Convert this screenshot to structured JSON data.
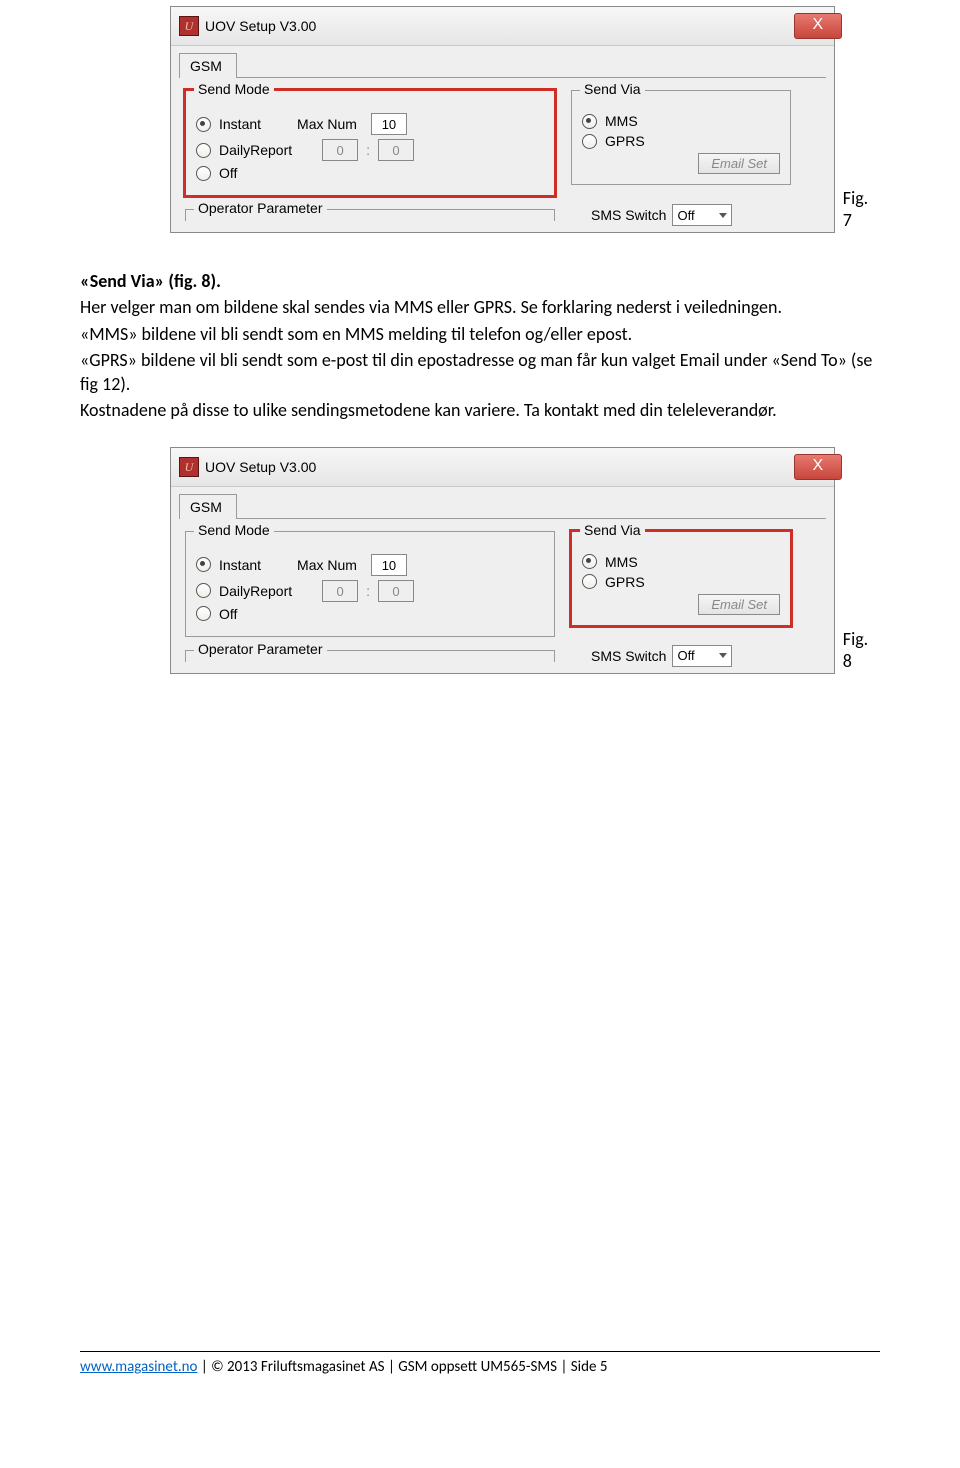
{
  "figures": {
    "fig7_caption": "Fig. 7",
    "fig8_caption": "Fig. 8"
  },
  "dialog": {
    "title": "UOV Setup V3.00",
    "icon_letter": "U",
    "close_symbol": "X",
    "tab_label": "GSM",
    "send_mode": {
      "group_title": "Send Mode",
      "instant_label": "Instant",
      "dailyreport_label": "DailyReport",
      "off_label": "Off",
      "maxnum_label": "Max Num",
      "maxnum_value": "10",
      "daily_h": "0",
      "daily_m": "0"
    },
    "send_via": {
      "group_title": "Send Via",
      "mms_label": "MMS",
      "gprs_label": "GPRS",
      "emailset_btn": "Email Set"
    },
    "operator_label": "Operator Parameter",
    "sms_switch_label": "SMS Switch",
    "sms_switch_value": "Off"
  },
  "text": {
    "heading": "«Send Via» (fig. 8).",
    "p1": "Her velger man om bildene skal sendes via MMS eller GPRS. Se forklaring nederst i veiledningen.",
    "p2": "«MMS» bildene vil bli sendt som en MMS melding til telefon og/eller epost.",
    "p3": "«GPRS» bildene vil bli sendt som e-post til din epostadresse og man får kun valget Email under «Send To» (se fig 12).",
    "p4": "Kostnadene på disse to ulike sendingsmetodene kan variere. Ta kontakt med din teleleverandør."
  },
  "footer": {
    "link": "www.magasinet.no",
    "sep": " |",
    "copyright": "© 2013 Friluftsmagasinet AS ",
    "sep2": "|",
    "doc": "GSM oppsett UM565-SMS ",
    "sep3": "|",
    "page": "Side 5"
  }
}
